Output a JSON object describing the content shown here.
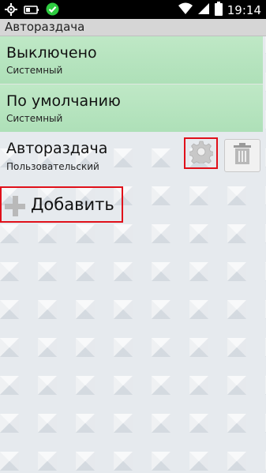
{
  "status_bar": {
    "left_icons": [
      "location-icon",
      "battery-saver-icon",
      "check-badge-icon"
    ],
    "right_icons": [
      "wifi-icon",
      "signal-icon",
      "battery-icon"
    ],
    "time": "19:14"
  },
  "app": {
    "title": "Авторaздача"
  },
  "profiles": [
    {
      "name": "Выключено",
      "type": "Системный",
      "highlighted": true
    },
    {
      "name": "По умолчанию",
      "type": "Системный",
      "highlighted": true
    },
    {
      "name": "Авторaздача",
      "type": "Пользовательский",
      "highlighted": false
    }
  ],
  "actions": {
    "settings_icon": "gear-icon",
    "delete_icon": "trash-icon",
    "add_label": "Добавить",
    "add_icon": "plus-icon"
  },
  "colors": {
    "highlight_green": "#b5e3bd",
    "annotation_red": "#e0101a",
    "status_green": "#2ecc40"
  }
}
